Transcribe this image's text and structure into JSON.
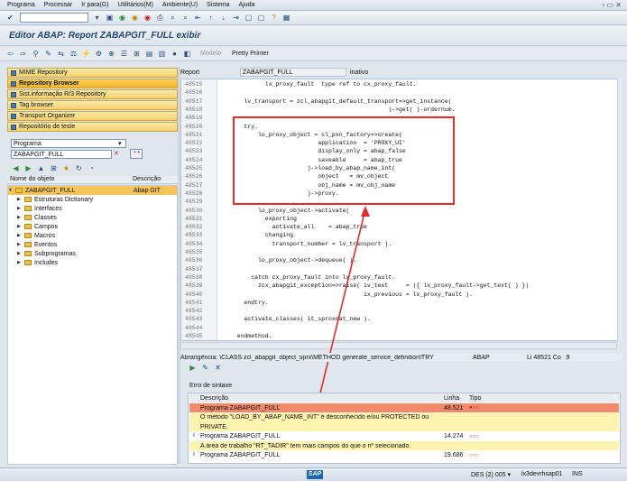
{
  "menu": [
    "Programa",
    "Processar",
    "Ir para(G)",
    "Utilitários(M)",
    "Ambiente(U)",
    "Sistema",
    "Ajuda"
  ],
  "title": "Editor ABAP: Report ZABAPGIT_FULL exibir",
  "toolbar2": {
    "modelo": "Modelo",
    "pretty": "Pretty Printer"
  },
  "nav": [
    "MIME Repository",
    "Repository Browser",
    "Sist.informação R/3 Repository",
    "Tag browser",
    "Transport Organizer",
    "Repositório de teste"
  ],
  "select": {
    "type": "Programa",
    "name": "ZABAPGIT_FULL"
  },
  "tree": {
    "col1": "Nome do objeto",
    "col2": "Descrição",
    "root": "ZABAPGIT_FULL",
    "root_desc": "Abap GIT",
    "items": [
      "Estruturas Dictionary",
      "Interfaces",
      "Classes",
      "Campos",
      "Macros",
      "Eventos",
      "Subprogramas",
      "Includes"
    ]
  },
  "editor": {
    "report_label": "Report",
    "report": "ZABAPGIT_FULL",
    "state": "inativo"
  },
  "code": [
    {
      "n": "48515",
      "t": "            lx_proxy_fault  type ref to cx_proxy_fault."
    },
    {
      "n": "48516",
      "t": ""
    },
    {
      "n": "48517",
      "t": "      lv_transport = zcl_abapgit_default_transport=>get_instance("
    },
    {
      "n": "48518",
      "t": "                                               )->get( )-ordernum."
    },
    {
      "n": "48519",
      "t": ""
    },
    {
      "n": "48520",
      "t": "      try."
    },
    {
      "n": "48521",
      "t": "          lo_proxy_object = cl_pxn_factory=>create("
    },
    {
      "n": "48522",
      "t": "                           application  = 'PROXY_UI'"
    },
    {
      "n": "48523",
      "t": "                           display_only = abap_false"
    },
    {
      "n": "48524",
      "t": "                           saveable     = abap_true"
    },
    {
      "n": "48525",
      "t": "                        )->load_by_abap_name_int("
    },
    {
      "n": "48526",
      "t": "                           object   = mv_object"
    },
    {
      "n": "48527",
      "t": "                           obj_name = mv_obj_name"
    },
    {
      "n": "48528",
      "t": "                        )->proxy."
    },
    {
      "n": "48529",
      "t": ""
    },
    {
      "n": "48530",
      "t": "          lo_proxy_object->activate("
    },
    {
      "n": "48531",
      "t": "            exporting"
    },
    {
      "n": "48532",
      "t": "              activate_all    = abap_true"
    },
    {
      "n": "48533",
      "t": "            changing"
    },
    {
      "n": "48534",
      "t": "              transport_number = lv_transport )."
    },
    {
      "n": "48535",
      "t": ""
    },
    {
      "n": "48536",
      "t": "          lo_proxy_object->dequeue( )."
    },
    {
      "n": "48537",
      "t": ""
    },
    {
      "n": "48538",
      "t": "        catch cx_proxy_fault into lx_proxy_fault."
    },
    {
      "n": "48539",
      "t": "          zcx_abapgit_exception=>raise( iv_text     = |{ lx_proxy_fault->get_text( ) }|"
    },
    {
      "n": "48540",
      "t": "                                        ix_previous = lx_proxy_fault )."
    },
    {
      "n": "48541",
      "t": "      endtry."
    },
    {
      "n": "48542",
      "t": ""
    },
    {
      "n": "48543",
      "t": "      activate_classes( it_sproxdat_new )."
    },
    {
      "n": "48544",
      "t": ""
    },
    {
      "n": "48545",
      "t": "    endmethod."
    }
  ],
  "status": {
    "scope": "Abrangência: \\CLASS zcl_abapgit_object_sprx\\METHOD generate_service_definition\\TRY",
    "lang": "ABAP",
    "pos": "Li 48521 Co   9"
  },
  "errors": {
    "title": "Erro de sintaxe",
    "h_desc": "Descrição",
    "h_line": "Linha",
    "h_type": "Tipo",
    "rows": [
      {
        "i": "",
        "t": "Programa ZABAPGIT_FULL",
        "l": "48.521",
        "kind": "err-head"
      },
      {
        "i": "",
        "t": "O método \"LOAD_BY_ABAP_NAME_INT\" é desconhecido e/ou PROTECTED ou",
        "l": "",
        "kind": "err"
      },
      {
        "i": "",
        "t": "PRIVATE.",
        "l": "",
        "kind": "err"
      },
      {
        "i": "i",
        "t": "Programa ZABAPGIT_FULL",
        "l": "14.274",
        "kind": "warn-head"
      },
      {
        "i": "",
        "t": "A área de trabalho \"RT_TADIR\" tem mais campos do que o nº selecionado.",
        "l": "",
        "kind": "warn"
      },
      {
        "i": "i",
        "t": "Programa ZABAPGIT_FULL",
        "l": "19.686",
        "kind": "warn-head"
      }
    ]
  },
  "statusbar": {
    "logo": "SAP",
    "sys": "DES (2) 005",
    "host": "lx3devrhsap01",
    "mode": "INS"
  },
  "colors": {
    "error": "#f28a6a",
    "warn": "#fff3b0",
    "accent": "#e52b2b"
  }
}
